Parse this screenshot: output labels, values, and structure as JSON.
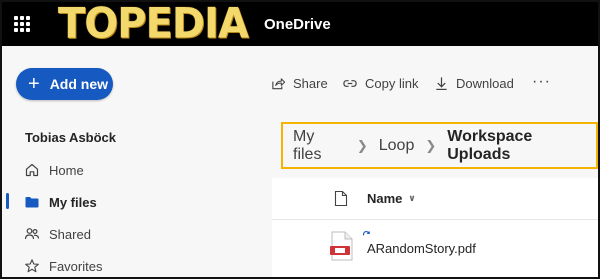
{
  "topbar": {
    "logo_text": "TOPEDIA",
    "app_name": "OneDrive"
  },
  "sidebar": {
    "add_new_label": "Add new",
    "user_name": "Tobias Asböck",
    "items": [
      {
        "label": "Home",
        "icon": "home-icon"
      },
      {
        "label": "My files",
        "icon": "folder-icon",
        "active": true
      },
      {
        "label": "Shared",
        "icon": "people-icon"
      },
      {
        "label": "Favorites",
        "icon": "star-icon"
      }
    ]
  },
  "toolbar": {
    "share_label": "Share",
    "copy_link_label": "Copy link",
    "download_label": "Download",
    "more_label": "···"
  },
  "breadcrumb": {
    "items": [
      "My files",
      "Loop",
      "Workspace Uploads"
    ]
  },
  "file_list": {
    "name_header": "Name",
    "files": [
      {
        "name": "ARandomStory.pdf",
        "type": "pdf"
      }
    ]
  },
  "colors": {
    "accent": "#1559c1",
    "highlight_border": "#f5b400",
    "logo": "#f3d96b",
    "pdf_red": "#d13438"
  }
}
